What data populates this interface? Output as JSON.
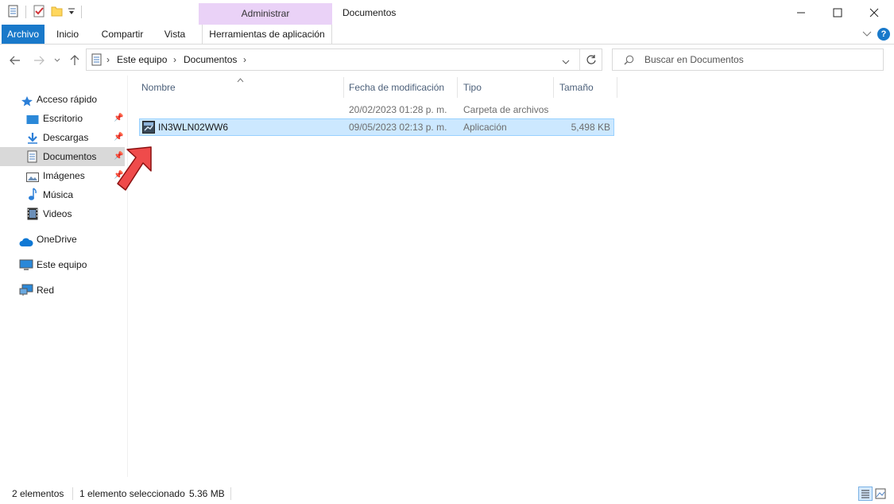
{
  "window": {
    "title": "Documentos",
    "context_tab_group": "Administrar",
    "context_color": "#ead2f7"
  },
  "ribbon": {
    "tabs": [
      {
        "label": "Archivo"
      },
      {
        "label": "Inicio"
      },
      {
        "label": "Compartir"
      },
      {
        "label": "Vista"
      },
      {
        "label": "Herramientas de aplicación"
      }
    ],
    "help_label": "?"
  },
  "address": {
    "breadcrumbs": [
      "Este equipo",
      "Documentos"
    ]
  },
  "search": {
    "placeholder": "Buscar en Documentos"
  },
  "sidebar": {
    "items": [
      {
        "label": "Acceso rápido",
        "icon": "star-icon"
      },
      {
        "label": "Escritorio",
        "icon": "desktop-icon",
        "pinned": true
      },
      {
        "label": "Descargas",
        "icon": "download-icon",
        "pinned": true
      },
      {
        "label": "Documentos",
        "icon": "documents-icon",
        "pinned": true,
        "selected": true
      },
      {
        "label": "Imágenes",
        "icon": "images-icon",
        "pinned": true
      },
      {
        "label": "Música",
        "icon": "music-icon"
      },
      {
        "label": "Videos",
        "icon": "videos-icon"
      },
      {
        "label": "OneDrive",
        "icon": "cloud-icon"
      },
      {
        "label": "Este equipo",
        "icon": "computer-icon"
      },
      {
        "label": "Red",
        "icon": "network-icon"
      }
    ]
  },
  "columns": {
    "name": "Nombre",
    "modified": "Fecha de modificación",
    "type": "Tipo",
    "size": "Tamaño"
  },
  "files": [
    {
      "name": "",
      "modified": "20/02/2023 01:28 p. m.",
      "type": "Carpeta de archivos",
      "size": ""
    },
    {
      "name": "IN3WLN02WW6",
      "modified": "09/05/2023 02:13 p. m.",
      "type": "Aplicación",
      "size": "5,498 KB",
      "selected": true
    }
  ],
  "status": {
    "count": "2 elementos",
    "selection": "1 elemento seleccionado",
    "selection_size": "5.36 MB"
  },
  "colors": {
    "accent": "#1979ca",
    "selection_bg": "#cce8ff",
    "selection_border": "#99d1ff",
    "annotation_arrow": "#ef4b4b"
  }
}
